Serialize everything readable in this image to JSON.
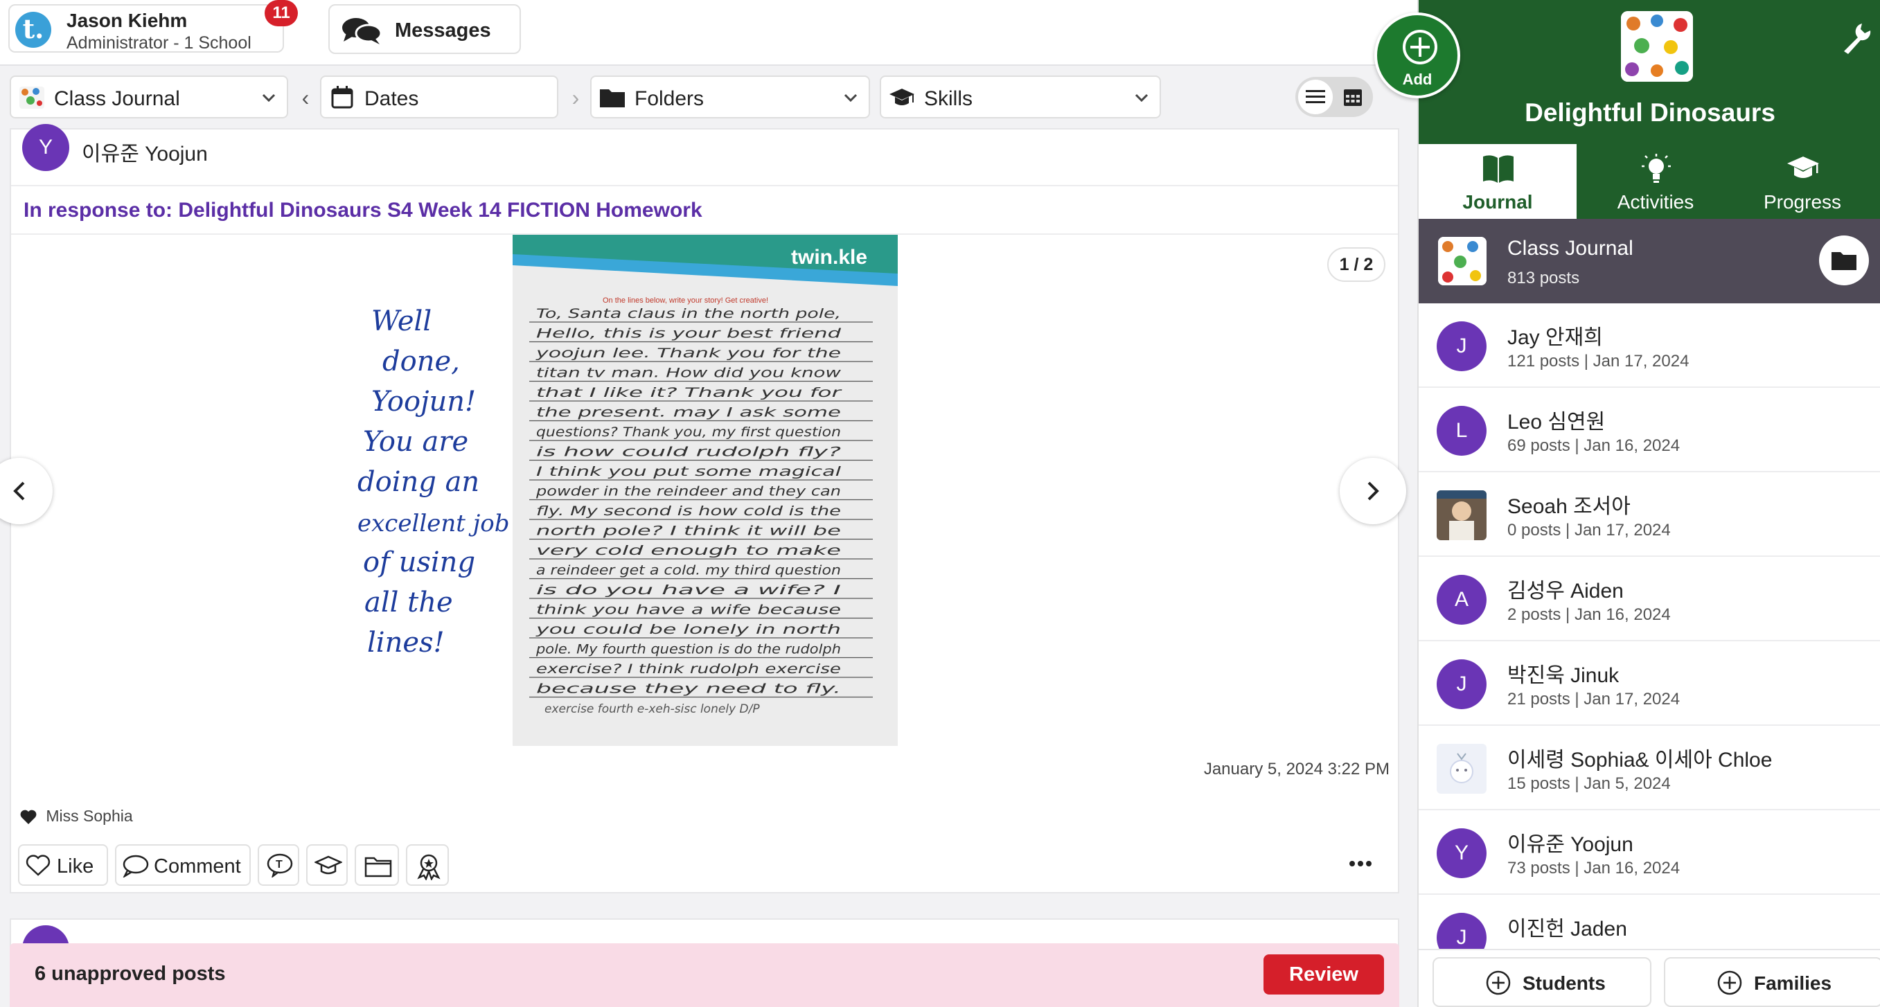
{
  "topbar": {
    "user_initial": "t.",
    "user_name": "Jason Kiehm",
    "user_role": "Administrator - 1 School",
    "notification_count": "11",
    "messages_label": "Messages"
  },
  "filters": {
    "journal": "Class Journal",
    "dates": "Dates",
    "folders": "Folders",
    "skills": "Skills"
  },
  "add_button": {
    "label": "Add"
  },
  "post": {
    "author_initials": "Y",
    "author_name": "이유준 Yoojun",
    "response_to": "In response to: Delightful Dinosaurs S4 Week 14 FICTION Homework",
    "page_counter": "1 / 2",
    "timestamp": "January 5, 2024 3:22 PM",
    "liked_by": "Miss Sophia",
    "actions": {
      "like": "Like",
      "comment": "Comment"
    },
    "worksheet": {
      "brand": "twin.kle",
      "instruction": "On the lines below, write your story! Get creative!",
      "teacher_note": [
        "Well",
        "done,",
        "Yoojun!",
        "You are",
        "doing an",
        "excellent job",
        "of using",
        "all the",
        "lines!"
      ],
      "student_lines": [
        "To, Santa claus in the north pole,",
        "Hello, this is your best friend",
        "yoojun lee. Thank you for the",
        "titan tv man. How did you know",
        "that I like it? Thank you for",
        "the present. may I ask some",
        "questions? Thank you, my first question",
        "is how could rudolph fly?",
        "I think you put some magical",
        "powder in the reindeer and they can",
        "fly. My second is how cold is the",
        "north pole? I think it will be",
        "very cold enough to make",
        "a reindeer get a cold. my third question",
        "is do you have a wife? I",
        "think you have a wife because",
        "you could be lonely in north",
        "pole. My fourth question is do the rudolph",
        "exercise? I think rudolph exercise",
        "because they need to fly."
      ],
      "footer_notes": "exercise   fourth   e-xeh-sisc   lonely   D/P"
    }
  },
  "banner": {
    "text": "6 unapproved posts",
    "review_label": "Review"
  },
  "sidebar": {
    "class_name": "Delightful Dinosaurs",
    "tabs": [
      {
        "label": "Journal",
        "icon": "book-icon"
      },
      {
        "label": "Activities",
        "icon": "lightbulb-icon"
      },
      {
        "label": "Progress",
        "icon": "graduation-cap-icon"
      }
    ],
    "journal": {
      "title": "Class Journal",
      "count": "813 posts"
    },
    "students": [
      {
        "initials": "J",
        "name": "Jay 안재희",
        "meta": "121 posts | Jan 17, 2024",
        "photo": false
      },
      {
        "initials": "L",
        "name": "Leo 심연원",
        "meta": "69 posts | Jan 16, 2024",
        "photo": false
      },
      {
        "initials": "",
        "name": "Seoah 조서아",
        "meta": "0 posts | Jan 17, 2024",
        "photo": true
      },
      {
        "initials": "A",
        "name": "김성우 Aiden",
        "meta": "2 posts | Jan 16, 2024",
        "photo": false
      },
      {
        "initials": "J",
        "name": "박진욱 Jinuk",
        "meta": "21 posts | Jan 17, 2024",
        "photo": false
      },
      {
        "initials": "",
        "name": "이세령 Sophia& 이세아 Chloe",
        "meta": "15 posts | Jan 5, 2024",
        "photo": true
      },
      {
        "initials": "Y",
        "name": "이유준 Yoojun",
        "meta": "73 posts | Jan 16, 2024",
        "photo": false
      },
      {
        "initials": "J",
        "name": "이진헌 Jaden",
        "meta": "",
        "photo": false
      }
    ],
    "footer": {
      "students": "Students",
      "families": "Families"
    }
  },
  "colors": {
    "brand_green": "#1f5e2a",
    "add_green": "#1d7a2e",
    "avatar_purple": "#6a35b5",
    "link_purple": "#5b2ea6",
    "review_red": "#d51f2a",
    "banner_pink": "#f9dbe6"
  }
}
